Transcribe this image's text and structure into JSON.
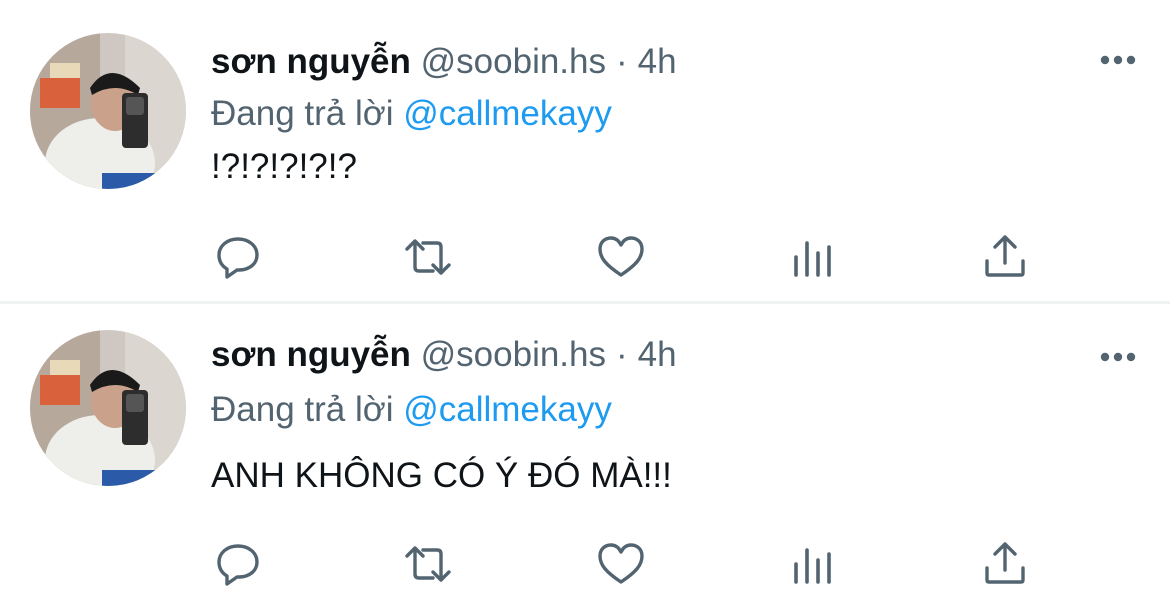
{
  "tweets": [
    {
      "author_name": "sơn nguyễn",
      "handle": "@soobin.hs",
      "separator": "·",
      "time": "4h",
      "reply_prefix": "Đang trả lời",
      "reply_to": "@callmekayy",
      "text": "!?!?!?!?!?"
    },
    {
      "author_name": "sơn nguyễn",
      "handle": "@soobin.hs",
      "separator": "·",
      "time": "4h",
      "reply_prefix": "Đang trả lời",
      "reply_to": "@callmekayy",
      "text": "ANH KHÔNG CÓ Ý ĐÓ MÀ!!!"
    }
  ],
  "actions": [
    "reply-icon",
    "retweet-icon",
    "like-icon",
    "stats-icon",
    "share-icon"
  ],
  "colors": {
    "text_primary": "#0f1419",
    "text_secondary": "#536471",
    "link": "#1d9bf0",
    "divider": "#eff3f4"
  }
}
